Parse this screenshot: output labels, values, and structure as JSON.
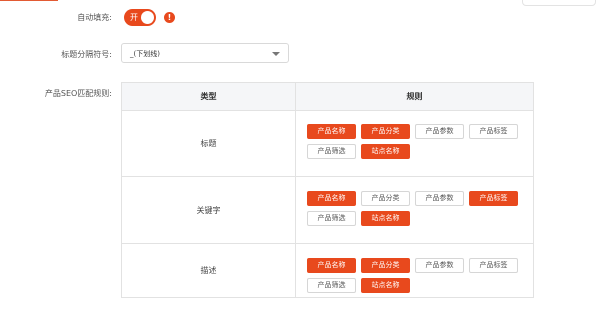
{
  "form": {
    "auto_fill": {
      "label": "自动填充:",
      "toggle_text": "开",
      "on": true,
      "info_icon": "info-icon"
    },
    "separator": {
      "label": "标题分隔符号:",
      "value": "_(下划线)"
    },
    "seo": {
      "label": "产品SEO匹配规则:"
    }
  },
  "table": {
    "headers": {
      "type": "类型",
      "rule": "规则"
    },
    "rows": [
      {
        "type": "标题",
        "tags": [
          {
            "label": "产品名称",
            "active": true
          },
          {
            "label": "产品分类",
            "active": true
          },
          {
            "label": "产品参数",
            "active": false
          },
          {
            "label": "产品标签",
            "active": false
          },
          {
            "label": "产品筛选",
            "active": false
          },
          {
            "label": "站点名称",
            "active": true
          }
        ]
      },
      {
        "type": "关键字",
        "tags": [
          {
            "label": "产品名称",
            "active": true
          },
          {
            "label": "产品分类",
            "active": false
          },
          {
            "label": "产品参数",
            "active": false
          },
          {
            "label": "产品标签",
            "active": true
          },
          {
            "label": "产品筛选",
            "active": false
          },
          {
            "label": "站点名称",
            "active": true
          }
        ]
      },
      {
        "type": "描述",
        "tags": [
          {
            "label": "产品名称",
            "active": true
          },
          {
            "label": "产品分类",
            "active": true
          },
          {
            "label": "产品参数",
            "active": false
          },
          {
            "label": "产品标签",
            "active": false
          },
          {
            "label": "产品筛选",
            "active": false
          },
          {
            "label": "站点名称",
            "active": true
          }
        ]
      }
    ]
  },
  "colors": {
    "accent": "#e8491d",
    "border": "#e2e2e2",
    "header_bg": "#f5f6f8"
  }
}
